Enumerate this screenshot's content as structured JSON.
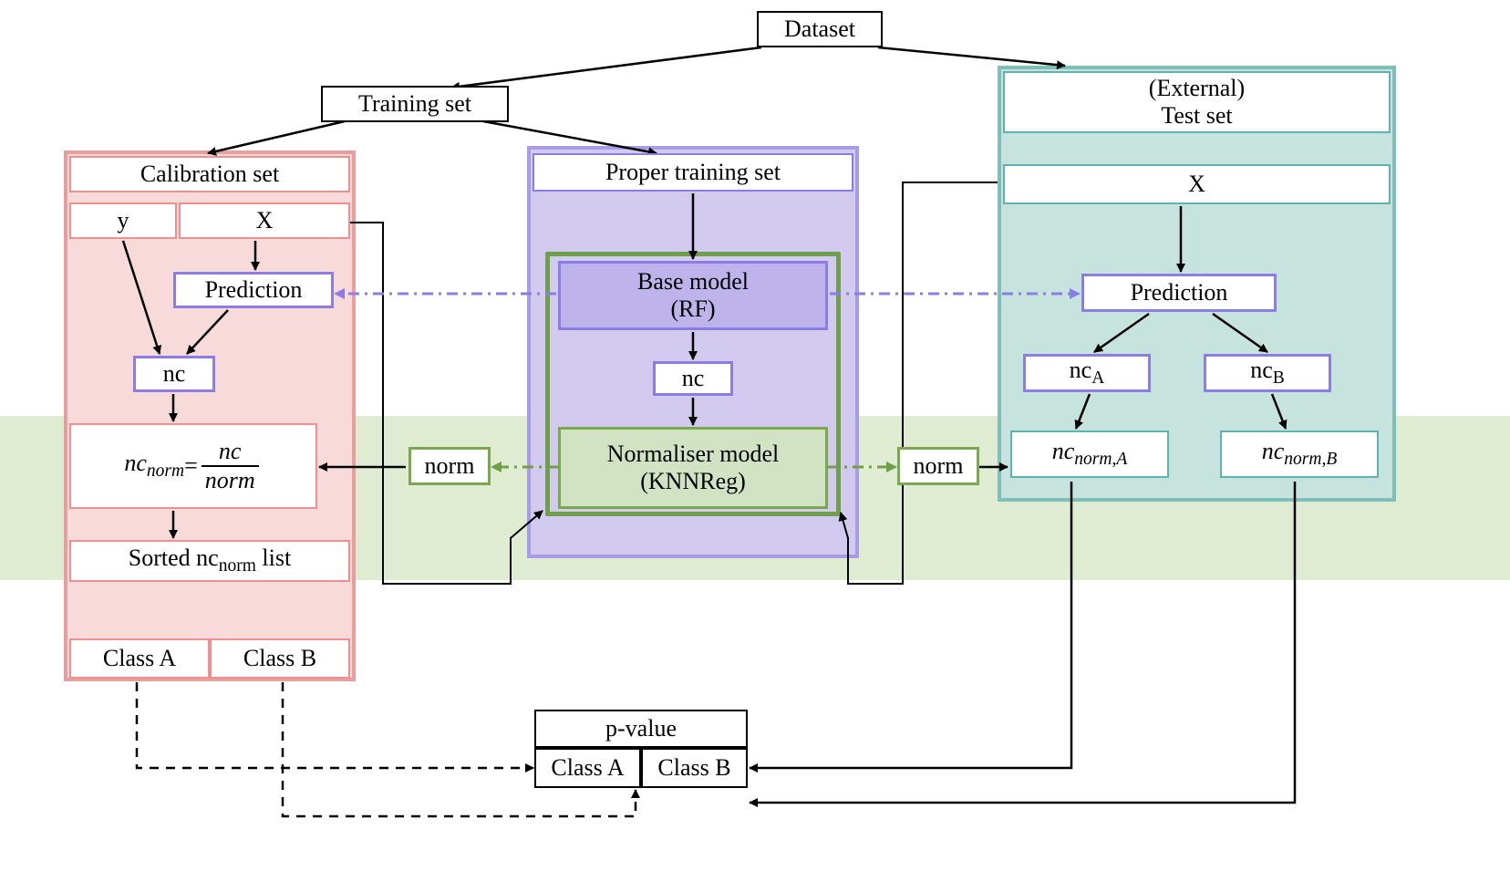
{
  "nodes": {
    "dataset": "Dataset",
    "training_set": "Training set",
    "test_set_line1": "(External)",
    "test_set_line2": "Test set",
    "calibration_set": "Calibration set",
    "proper_training_set": "Proper training set",
    "cal_y": "y",
    "cal_X": "X",
    "test_X": "X",
    "prediction_cal": "Prediction",
    "prediction_test": "Prediction",
    "nc_cal": "nc",
    "nc_mid": "nc",
    "nc_A_label": "nc",
    "nc_A_sub": "A",
    "nc_B_label": "nc",
    "nc_B_sub": "B",
    "norm_left": "norm",
    "norm_right": "norm",
    "base_model_line1": "Base model",
    "base_model_line2": "(RF)",
    "normaliser_line1": "Normaliser model",
    "normaliser_line2": "(KNNReg)",
    "ncnorm_eq_lhs_nc": "nc",
    "ncnorm_eq_lhs_sub": "norm",
    "ncnorm_eq_eq": " = ",
    "ncnorm_eq_num": "nc",
    "ncnorm_eq_den": "norm",
    "sorted_label_pre": "Sorted nc",
    "sorted_label_sub": "norm",
    "sorted_label_post": " list",
    "class_a": "Class A",
    "class_b": "Class B",
    "pvalue": "p-value",
    "p_class_a": "Class A",
    "p_class_b": "Class B",
    "ncnormA_nc": "nc",
    "ncnormA_sub": "norm,A",
    "ncnormB_nc": "nc",
    "ncnormB_sub": "norm,B"
  },
  "colors": {
    "pink": "#f9dada",
    "purple": "#d3cbef",
    "teal": "#c7e3de",
    "green_band": "#dfecd2",
    "arrow_purple": "#8a7ee6",
    "arrow_green": "#6f9f49"
  }
}
